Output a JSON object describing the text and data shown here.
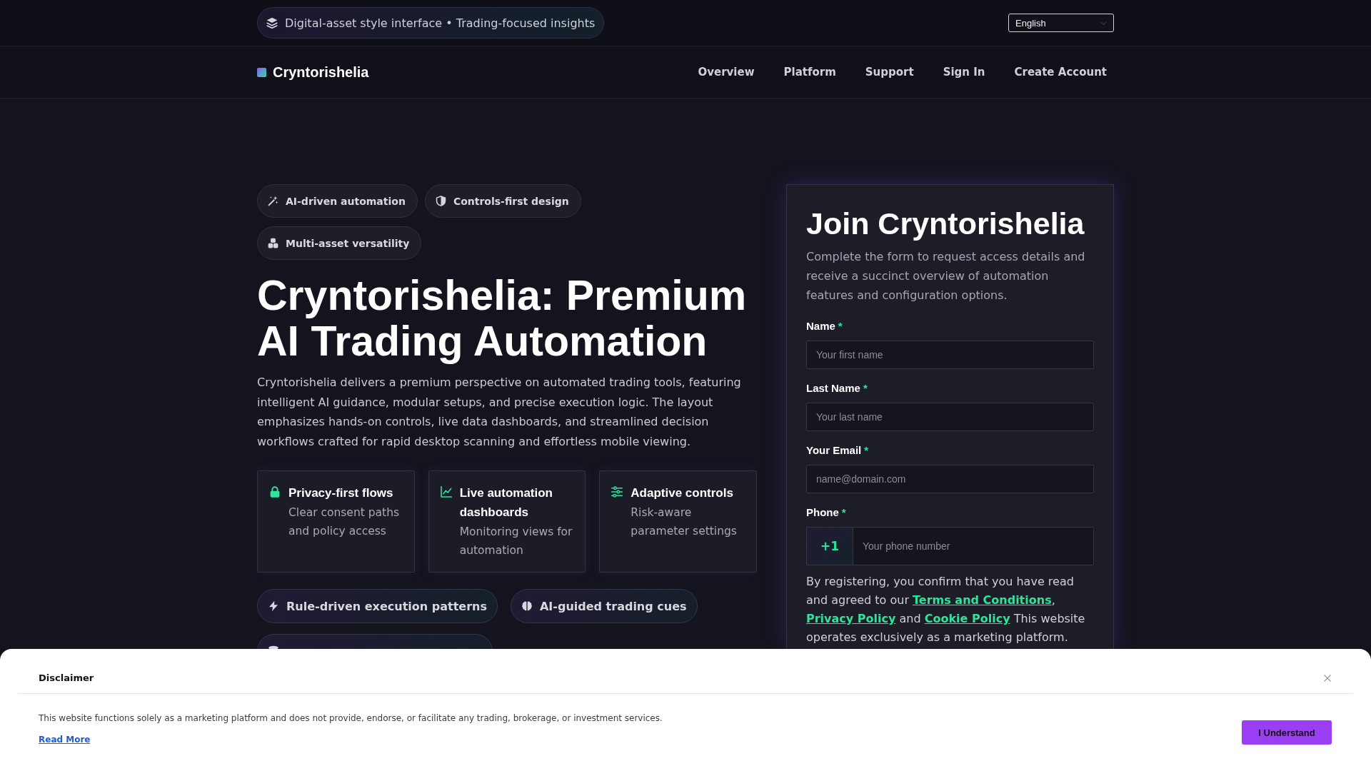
{
  "top_bar": {
    "notice": "Digital-asset style interface • Trading-focused insights",
    "language": "English"
  },
  "nav": {
    "brand": "Cryntorishelia",
    "links": [
      "Overview",
      "Platform",
      "Support",
      "Sign In",
      "Create Account"
    ]
  },
  "hero": {
    "tags": [
      "AI-driven automation",
      "Controls-first design",
      "Multi-asset versatility"
    ],
    "title": "Cryntorishelia: Premium AI Trading Automation",
    "description": "Cryntorishelia delivers a premium perspective on automated trading tools, featuring intelligent AI guidance, modular setups, and precise execution logic. The layout emphasizes hands-on controls, live data dashboards, and streamlined decision workflows crafted for rapid desktop scanning and effortless mobile viewing.",
    "features": [
      {
        "title": "Privacy-first flows",
        "text": "Clear consent paths and policy access"
      },
      {
        "title": "Live automation dashboards",
        "text": "Monitoring views for automation"
      },
      {
        "title": "Adaptive controls",
        "text": "Risk-aware parameter settings"
      }
    ],
    "pills": [
      "Rule-driven execution patterns",
      "AI-guided trading cues"
    ]
  },
  "signup": {
    "title": "Join Cryntorishelia",
    "intro": "Complete the form to request access details and receive a succinct overview of automation features and configuration options.",
    "fields": [
      {
        "kind": "text",
        "label": "Name",
        "required_mark": "*",
        "placeholder": "Your first name"
      },
      {
        "kind": "text",
        "label": "Last Name",
        "required_mark": "*",
        "placeholder": "Your last name"
      },
      {
        "kind": "email",
        "label": "Your Email",
        "required_mark": "*",
        "placeholder": "name@domain.com"
      },
      {
        "kind": "phone",
        "label": "Phone",
        "required_mark": "*",
        "prefix": "+1",
        "placeholder": "Your phone number"
      }
    ],
    "consent": [
      {
        "kind": "text",
        "text": "By registering, you confirm that you have read and agreed to our "
      },
      {
        "kind": "link",
        "text": "Terms and Conditions"
      },
      {
        "kind": "text",
        "text": ", "
      },
      {
        "kind": "link",
        "text": "Privacy Policy"
      },
      {
        "kind": "text",
        "text": " and "
      },
      {
        "kind": "link",
        "text": "Cookie Policy"
      },
      {
        "kind": "text",
        "text": " This website operates exclusively as a marketing platform."
      }
    ]
  },
  "disclaimer": {
    "title": "Disclaimer",
    "text": "This website functions solely as a marketing platform and does not provide, endorse, or facilitate any trading, brokerage, or investment services.",
    "link": "Read More",
    "button": "I Understand"
  }
}
